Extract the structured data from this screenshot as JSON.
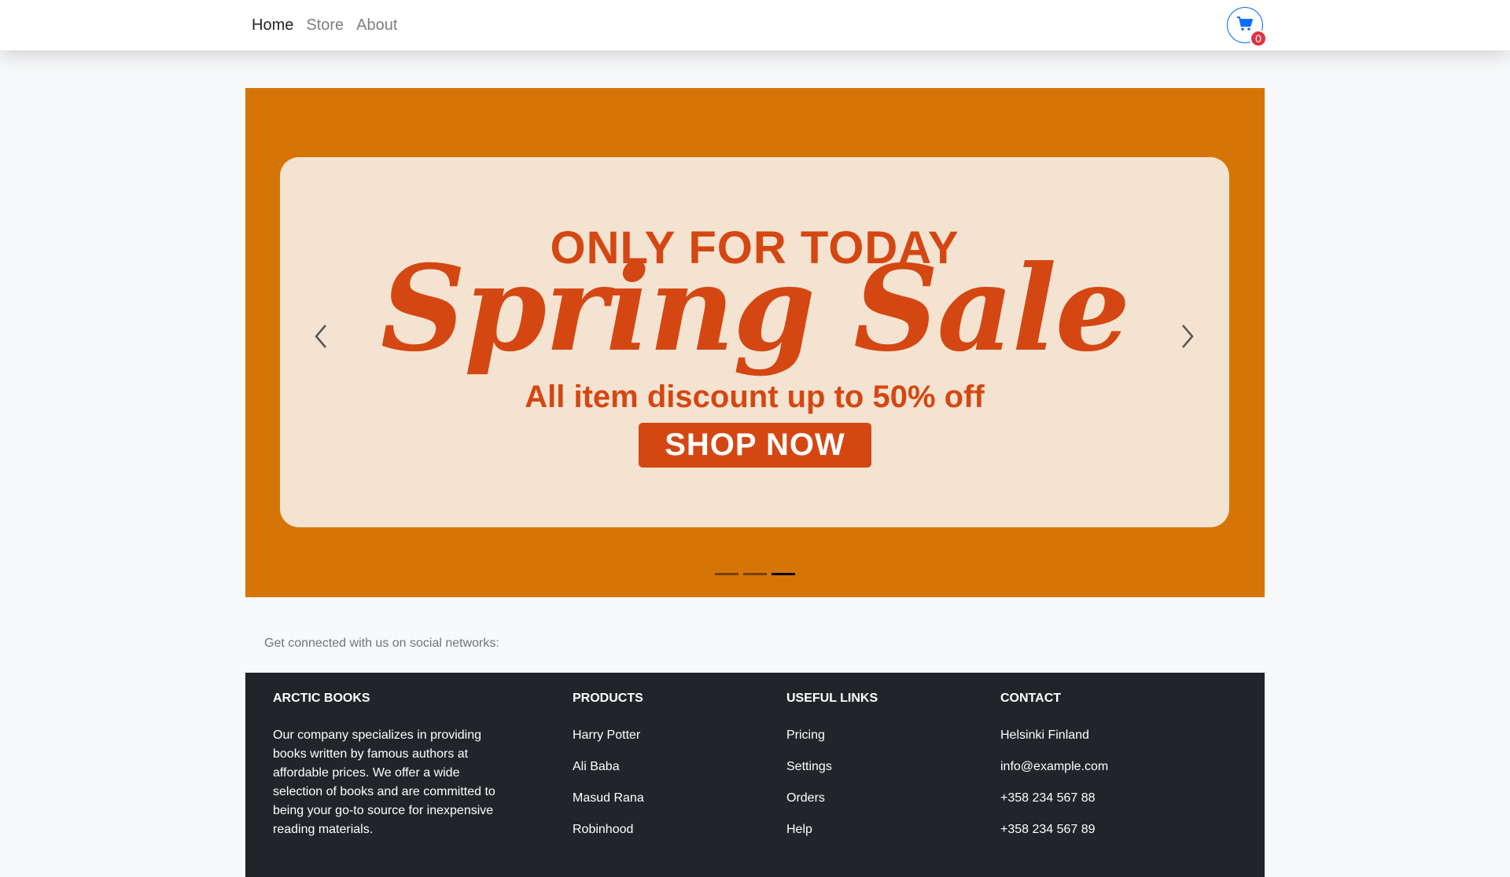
{
  "nav": {
    "links": [
      {
        "label": "Home",
        "active": true
      },
      {
        "label": "Store",
        "active": false
      },
      {
        "label": "About",
        "active": false
      }
    ],
    "cart_count": "0",
    "cart_icon": "cart-icon"
  },
  "carousel": {
    "slide": {
      "kicker": "ONLY FOR TODAY",
      "title": "Spring Sale",
      "subtitle": "All item discount up to 50% off",
      "cta": "SHOP NOW"
    },
    "indicator_count": 3,
    "active_index": 2,
    "prev_icon": "chevron-left-icon",
    "next_icon": "chevron-right-icon"
  },
  "social": {
    "text": "Get connected with us on social networks:"
  },
  "footer": {
    "about": {
      "heading": "ARCTIC BOOKS",
      "text": "Our company specializes in providing books written by famous authors at affordable prices. We offer a wide selection of books and are committed to being your go-to source for inexpensive reading materials."
    },
    "products": {
      "heading": "PRODUCTS",
      "items": [
        "Harry Potter",
        "Ali Baba",
        "Masud Rana",
        "Robinhood"
      ]
    },
    "useful_links": {
      "heading": "USEFUL LINKS",
      "items": [
        "Pricing",
        "Settings",
        "Orders",
        "Help"
      ]
    },
    "contact": {
      "heading": "CONTACT",
      "items": [
        "Helsinki Finland",
        "info@example.com",
        "+358 234 567 88",
        "+358 234 567 89"
      ]
    }
  },
  "colors": {
    "banner_bg": "#d67507",
    "banner_panel": "#f5e3d1",
    "sale_text": "#d44712",
    "cart_border": "#0d6efd",
    "badge": "#dc3545",
    "footer_bg": "#212529"
  }
}
